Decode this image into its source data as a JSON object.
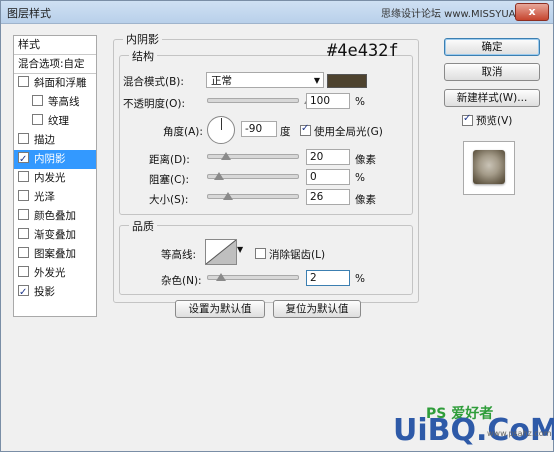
{
  "window": {
    "title": "图层样式",
    "watermark_top": "思缘设计论坛 www.MISSYUAN.COM",
    "close": "x"
  },
  "left": {
    "header": "样式",
    "blend_options": "混合选项:自定",
    "items": [
      {
        "label": "斜面和浮雕",
        "checked": false,
        "sub": false,
        "selected": false
      },
      {
        "label": "等高线",
        "checked": false,
        "sub": true,
        "selected": false
      },
      {
        "label": "纹理",
        "checked": false,
        "sub": true,
        "selected": false
      },
      {
        "label": "描边",
        "checked": false,
        "sub": false,
        "selected": false
      },
      {
        "label": "内阴影",
        "checked": true,
        "sub": false,
        "selected": true
      },
      {
        "label": "内发光",
        "checked": false,
        "sub": false,
        "selected": false
      },
      {
        "label": "光泽",
        "checked": false,
        "sub": false,
        "selected": false
      },
      {
        "label": "颜色叠加",
        "checked": false,
        "sub": false,
        "selected": false
      },
      {
        "label": "渐变叠加",
        "checked": false,
        "sub": false,
        "selected": false
      },
      {
        "label": "图案叠加",
        "checked": false,
        "sub": false,
        "selected": false
      },
      {
        "label": "外发光",
        "checked": false,
        "sub": false,
        "selected": false
      },
      {
        "label": "投影",
        "checked": true,
        "sub": false,
        "selected": false
      }
    ]
  },
  "inner_shadow": {
    "title": "内阴影",
    "structure": "结构",
    "color_hex_label": "#4e432f",
    "swatch_color": "#4e432f",
    "blend_mode_label": "混合模式(B):",
    "blend_mode_value": "正常",
    "opacity_label": "不透明度(O):",
    "opacity_value": "100",
    "opacity_unit": "%",
    "opacity_level": 1.0,
    "angle_label": "角度(A):",
    "angle_value": "-90",
    "angle_unit": "度",
    "global_light_label": "使用全局光(G)",
    "global_light_checked": true,
    "distance_label": "距离(D):",
    "distance_value": "20",
    "distance_unit": "像素",
    "distance_level": 0.08,
    "choke_label": "阻塞(C):",
    "choke_value": "0",
    "choke_unit": "%",
    "choke_level": 0.0,
    "size_label": "大小(S):",
    "size_value": "26",
    "size_unit": "像素",
    "size_level": 0.1,
    "quality": "品质",
    "contour_label": "等高线:",
    "antialias_label": "消除锯齿(L)",
    "antialias_checked": false,
    "noise_label": "杂色(N):",
    "noise_value": "2",
    "noise_unit": "%",
    "noise_level": 0.02,
    "set_default": "设置为默认值",
    "reset_default": "复位为默认值"
  },
  "right": {
    "ok": "确定",
    "cancel": "取消",
    "new_style": "新建样式(W)...",
    "preview_label": "预览(V)",
    "preview_checked": true
  },
  "watermark": {
    "main": "UiBQ.CoM",
    "ps": "PS 爱好者",
    "small": "www.psahz.com"
  }
}
